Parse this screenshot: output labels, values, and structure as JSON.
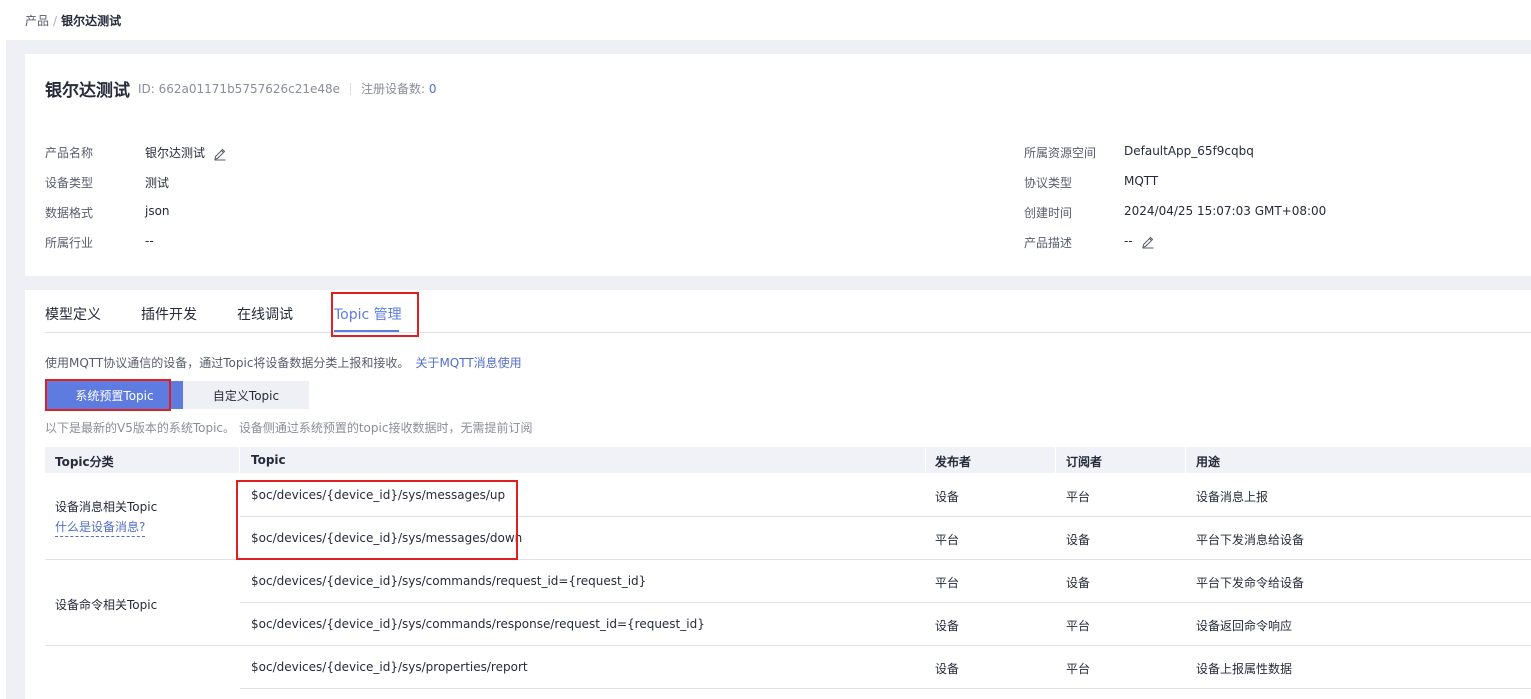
{
  "breadcrumb": {
    "parent": "产品",
    "separator": "/",
    "current": "银尔达测试"
  },
  "product": {
    "name": "银尔达测试",
    "id_text": "ID: 662a01171b5757626c21e48e",
    "registered_label": "注册设备数:",
    "registered_count": "0"
  },
  "info_left": [
    {
      "key": "产品名称",
      "value": "银尔达测试"
    },
    {
      "key": "设备类型",
      "value": "测试"
    },
    {
      "key": "数据格式",
      "value": "json"
    },
    {
      "key": "所属行业",
      "value": "--"
    }
  ],
  "info_right": [
    {
      "key": "所属资源空间",
      "value": "DefaultApp_65f9cqbq"
    },
    {
      "key": "协议类型",
      "value": "MQTT"
    },
    {
      "key": "创建时间",
      "value": "2024/04/25 15:07:03 GMT+08:00"
    },
    {
      "key": "产品描述",
      "value": "--"
    }
  ],
  "tabs": [
    {
      "label": "模型定义"
    },
    {
      "label": "插件开发"
    },
    {
      "label": "在线调试"
    },
    {
      "label": "Topic 管理"
    }
  ],
  "active_tab": "Topic 管理",
  "description": "使用MQTT协议通信的设备，通过Topic将设备数据分类上报和接收。",
  "description_link": "关于MQTT消息使用",
  "buttons": {
    "preset": "系统预置Topic",
    "custom": "自定义Topic"
  },
  "note": "以下是最新的V5版本的系统Topic。 设备侧通过系统预置的topic接收数据时，无需提前订阅",
  "table": {
    "headers": [
      "Topic分类",
      "Topic",
      "发布者",
      "订阅者",
      "用途"
    ],
    "groups": [
      {
        "category": "设备消息相关Topic",
        "link": "什么是设备消息?"
      },
      {
        "category": "设备命令相关Topic",
        "link": ""
      }
    ],
    "rows": [
      {
        "topic": "$oc/devices/{device_id}/sys/messages/up",
        "publisher": "设备",
        "subscriber": "平台",
        "purpose": "设备消息上报"
      },
      {
        "topic": "$oc/devices/{device_id}/sys/messages/down",
        "publisher": "平台",
        "subscriber": "设备",
        "purpose": "平台下发消息给设备"
      },
      {
        "topic": "$oc/devices/{device_id}/sys/commands/request_id={request_id}",
        "publisher": "平台",
        "subscriber": "设备",
        "purpose": "平台下发命令给设备"
      },
      {
        "topic": "$oc/devices/{device_id}/sys/commands/response/request_id={request_id}",
        "publisher": "设备",
        "subscriber": "平台",
        "purpose": "设备返回命令响应"
      },
      {
        "topic": "$oc/devices/{device_id}/sys/properties/report",
        "publisher": "设备",
        "subscriber": "平台",
        "purpose": "设备上报属性数据"
      }
    ]
  },
  "colors": {
    "accent": "#5e7ce0",
    "highlight": "#e02020",
    "link": "#526ecc"
  }
}
